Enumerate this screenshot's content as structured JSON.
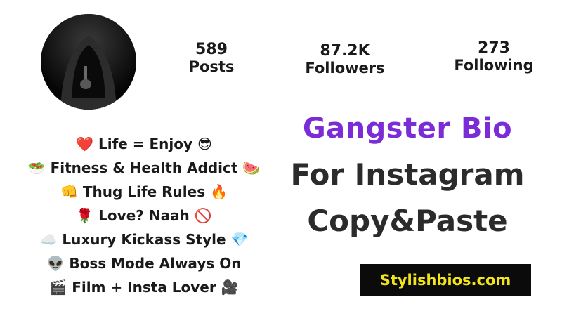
{
  "profile": {
    "avatar_icon": "hooded-figure-avatar",
    "stats": [
      {
        "value": "589",
        "label": "Posts"
      },
      {
        "value": "87.2K",
        "label": "Followers"
      },
      {
        "value": "273",
        "label": "Following"
      }
    ]
  },
  "bio": {
    "lines": [
      "❤️ Life = Enjoy 😎",
      "🥗 Fitness & Health Addict 🍉",
      "👊 Thug Life Rules 🔥",
      "🌹 Love? Naah 🚫",
      "☁️ Luxury Kickass Style 💎",
      "👽 Boss Mode Always On",
      "🎬 Film + Insta Lover 🎥"
    ]
  },
  "headline": {
    "line1": "Gangster Bio",
    "line2": "For Instagram",
    "line3": "Copy&Paste",
    "accent_color": "#7b2cd6"
  },
  "site": {
    "label": "Stylishbios.com",
    "bg_color": "#0b0b0b",
    "text_color": "#f2e61a"
  }
}
